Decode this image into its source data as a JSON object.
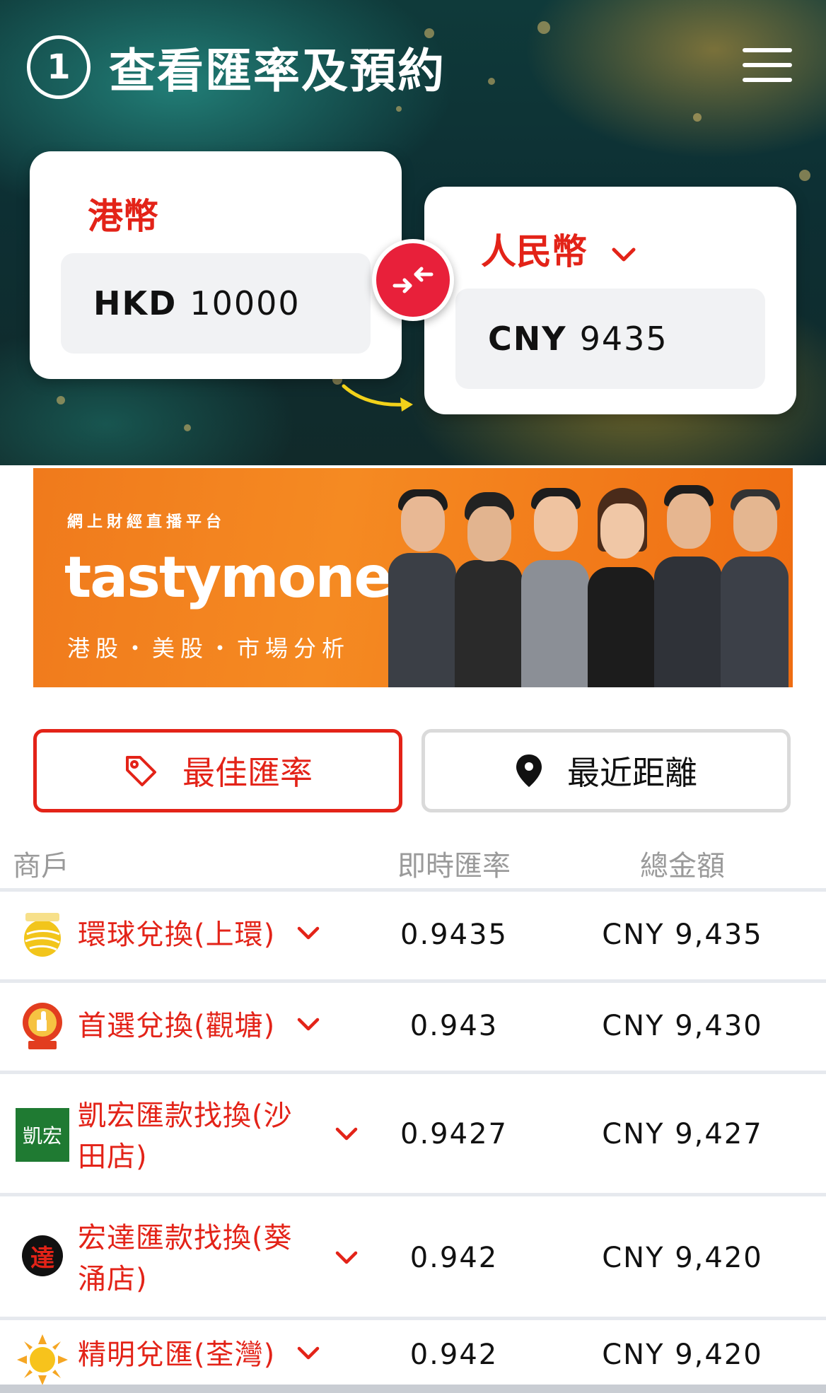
{
  "header": {
    "step_number": "1",
    "title": "查看匯率及預約",
    "menu_icon": "hamburger-menu-icon"
  },
  "converter": {
    "from": {
      "label": "港幣",
      "currency_code": "HKD",
      "amount": "10000"
    },
    "to": {
      "label": "人民幣",
      "currency_code": "CNY",
      "amount": "9435"
    },
    "swap_icon": "swap-arrows-icon",
    "accent_color": "#e32318"
  },
  "banner": {
    "subtitle": "網上財經直播平台",
    "brand": "tastymoney",
    "tagline": "港股・美股・市場分析",
    "background_color": "#f07a1c"
  },
  "sort": {
    "best_rate_label": "最佳匯率",
    "nearest_label": "最近距離",
    "selected": "best_rate"
  },
  "table": {
    "headers": {
      "merchant": "商戶",
      "rate": "即時匯率",
      "total": "總金額"
    },
    "rows": [
      {
        "name": "環球兌換(上環)",
        "rate": "0.9435",
        "total": "CNY 9,435",
        "logo": "globe-exchange-logo-icon"
      },
      {
        "name": "首選兌換(觀塘)",
        "rate": "0.943",
        "total": "CNY 9,430",
        "logo": "thumbs-up-badge-logo-icon"
      },
      {
        "name": "凱宏匯款找換(沙田店)",
        "name_line1": "凱宏匯款找換(沙",
        "name_line2": "田店)",
        "rate": "0.9427",
        "total": "CNY 9,427",
        "logo": "kai-wang-logo-icon",
        "logo_text": "凱宏"
      },
      {
        "name": "宏達匯款找換(葵涌店)",
        "name_line1": "宏達匯款找換(葵",
        "name_line2": "涌店)",
        "rate": "0.942",
        "total": "CNY 9,420",
        "logo": "wang-tat-logo-icon",
        "logo_text": "達"
      },
      {
        "name": "精明兌匯(荃灣)",
        "rate": "0.942",
        "total": "CNY 9,420",
        "logo": "sun-logo-icon"
      }
    ]
  }
}
